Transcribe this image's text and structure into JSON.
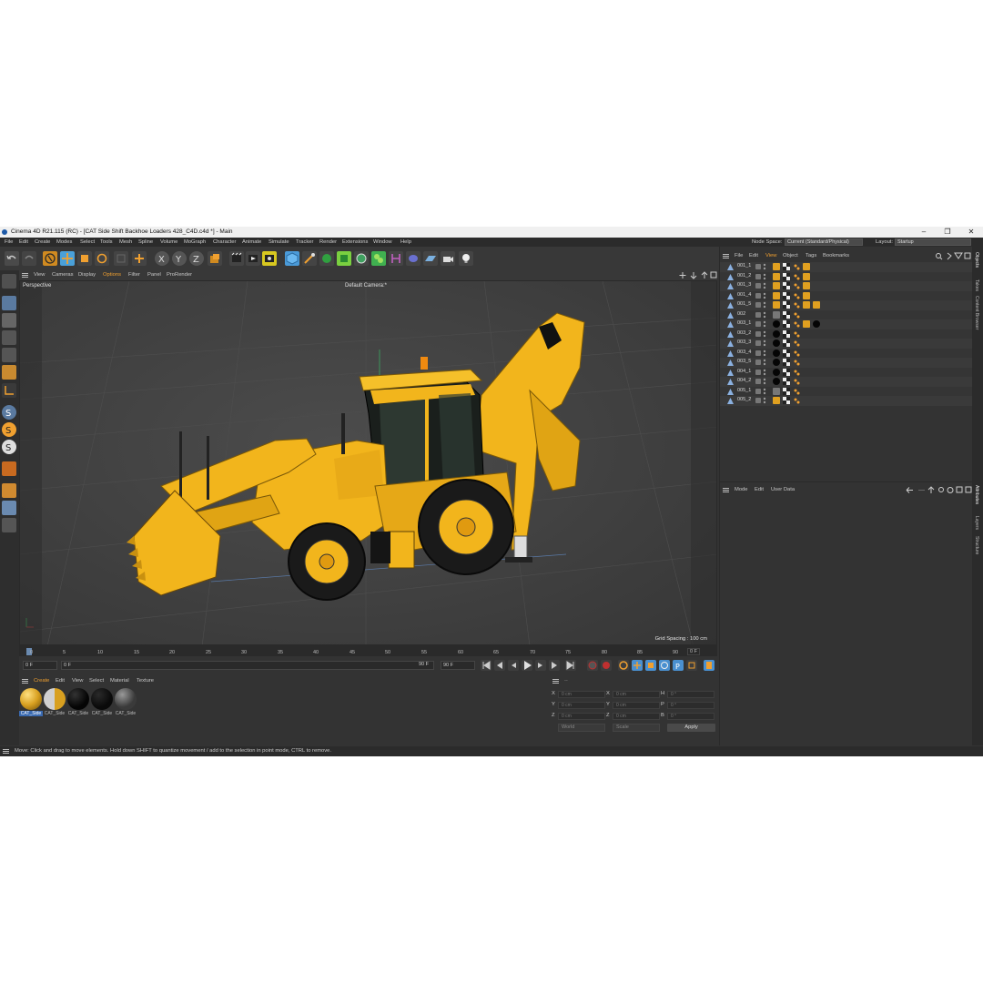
{
  "window": {
    "title": "Cinema 4D R21.115 (RC) - [CAT Side Shift Backhoe Loaders 428_C4D.c4d *] - Main",
    "minimize": "–",
    "maximize": "❐",
    "close": "✕"
  },
  "menubar": {
    "items": [
      "File",
      "Edit",
      "Create",
      "Modes",
      "Select",
      "Tools",
      "Mesh",
      "Spline",
      "Volume",
      "MoGraph",
      "Character",
      "Animate",
      "Simulate",
      "Tracker",
      "Render",
      "Extensions",
      "Window",
      "Help"
    ],
    "node_space_label": "Node Space:",
    "node_space_value": "Current (Standard/Physical)",
    "layout_label": "Layout:",
    "layout_value": "Startup"
  },
  "toolbar": {
    "icons": [
      "undo-icon",
      "redo-icon",
      "live-selection-icon",
      "move-icon",
      "scale-icon",
      "rotate-icon",
      "recent-tools-icon",
      "add-icon",
      "x-axis-icon",
      "y-axis-icon",
      "z-axis-icon",
      "coordinate-system-icon",
      "render-view-icon",
      "render-picture-viewer-icon",
      "edit-render-settings-icon",
      "cube-icon",
      "pen-icon",
      "subdivision-icon",
      "spline-generator-icon",
      "cloner-icon",
      "mograph-icon",
      "deformer-icon",
      "field-icon",
      "floor-icon",
      "camera-icon",
      "light-icon"
    ]
  },
  "viewport": {
    "menu": [
      "View",
      "Cameras",
      "Display",
      "Options",
      "Filter",
      "Panel",
      "ProRender"
    ],
    "label": "Perspective",
    "camera": "Default Camera:*",
    "grid_spacing": "Grid Spacing : 100 cm"
  },
  "timeline": {
    "ticks": [
      "0",
      "5",
      "10",
      "15",
      "20",
      "25",
      "30",
      "35",
      "40",
      "45",
      "50",
      "55",
      "60",
      "65",
      "70",
      "75",
      "80",
      "85",
      "90"
    ],
    "current_frame": "0 F",
    "start_frame": "0 F",
    "range_start": "0 F",
    "range_end": "90 F",
    "end_frame": "90 F"
  },
  "materials": {
    "menu": [
      "Create",
      "Edit",
      "View",
      "Select",
      "Material",
      "Texture"
    ],
    "items": [
      {
        "label": "CAT_Side",
        "color": "#d8a020"
      },
      {
        "label": "CAT_Side",
        "color": "#888888"
      },
      {
        "label": "CAT_Side",
        "color": "#050505"
      },
      {
        "label": "CAT_Side",
        "color": "#0a0a0a"
      },
      {
        "label": "CAT_Side",
        "color": "#3a3a3a"
      }
    ]
  },
  "coordinates": {
    "header": "--",
    "rows": [
      {
        "a": "X",
        "av": "0 cm",
        "b": "X",
        "bv": "0 cm",
        "c": "H",
        "cv": "0 °"
      },
      {
        "a": "Y",
        "av": "0 cm",
        "b": "Y",
        "bv": "0 cm",
        "c": "P",
        "cv": "0 °"
      },
      {
        "a": "Z",
        "av": "0 cm",
        "b": "Z",
        "bv": "0 cm",
        "c": "B",
        "cv": "0 °"
      }
    ],
    "world": "World",
    "scale": "Scale",
    "apply": "Apply"
  },
  "objects": {
    "menu": [
      "File",
      "Edit",
      "View",
      "Object",
      "Tags",
      "Bookmarks"
    ],
    "rows": [
      {
        "name": "001_1",
        "tags": [
          "gold",
          "checker",
          "dots",
          "gold"
        ]
      },
      {
        "name": "001_2",
        "tags": [
          "gold",
          "checker",
          "dots",
          "gold"
        ]
      },
      {
        "name": "001_3",
        "tags": [
          "gold",
          "checker",
          "dots",
          "gold"
        ]
      },
      {
        "name": "001_4",
        "tags": [
          "gold",
          "checker",
          "dots",
          "gold"
        ]
      },
      {
        "name": "001_5",
        "tags": [
          "gold",
          "checker",
          "dots",
          "gold",
          "gold"
        ]
      },
      {
        "name": "002",
        "tags": [
          "gray",
          "checker",
          "dots"
        ]
      },
      {
        "name": "003_1",
        "tags": [
          "black",
          "checker",
          "dots",
          "gold",
          "black"
        ]
      },
      {
        "name": "003_2",
        "tags": [
          "black",
          "checker",
          "dots"
        ]
      },
      {
        "name": "003_3",
        "tags": [
          "black",
          "checker",
          "dots"
        ]
      },
      {
        "name": "003_4",
        "tags": [
          "black",
          "checker",
          "dots"
        ]
      },
      {
        "name": "003_5",
        "tags": [
          "black",
          "checker",
          "dots"
        ]
      },
      {
        "name": "004_1",
        "tags": [
          "black",
          "checker",
          "dots"
        ]
      },
      {
        "name": "004_2",
        "tags": [
          "black",
          "checker",
          "dots"
        ]
      },
      {
        "name": "005_1",
        "tags": [
          "gray",
          "checker",
          "dots"
        ]
      },
      {
        "name": "005_2",
        "tags": [
          "gold",
          "checker",
          "dots"
        ]
      }
    ]
  },
  "attributes": {
    "menu": [
      "Mode",
      "Edit",
      "User Data"
    ]
  },
  "side_tabs": [
    "Objects",
    "Takes",
    "Content Browser",
    "Attributes",
    "Layers",
    "Structure"
  ],
  "status": {
    "text": "Move: Click and drag to move elements. Hold down SHIFT to quantize movement / add to the selection in point mode, CTRL to remove."
  },
  "colors": {
    "accent_orange": "#f0a030",
    "machine_yellow": "#f2b51c",
    "viewport_bg": "#444444"
  }
}
